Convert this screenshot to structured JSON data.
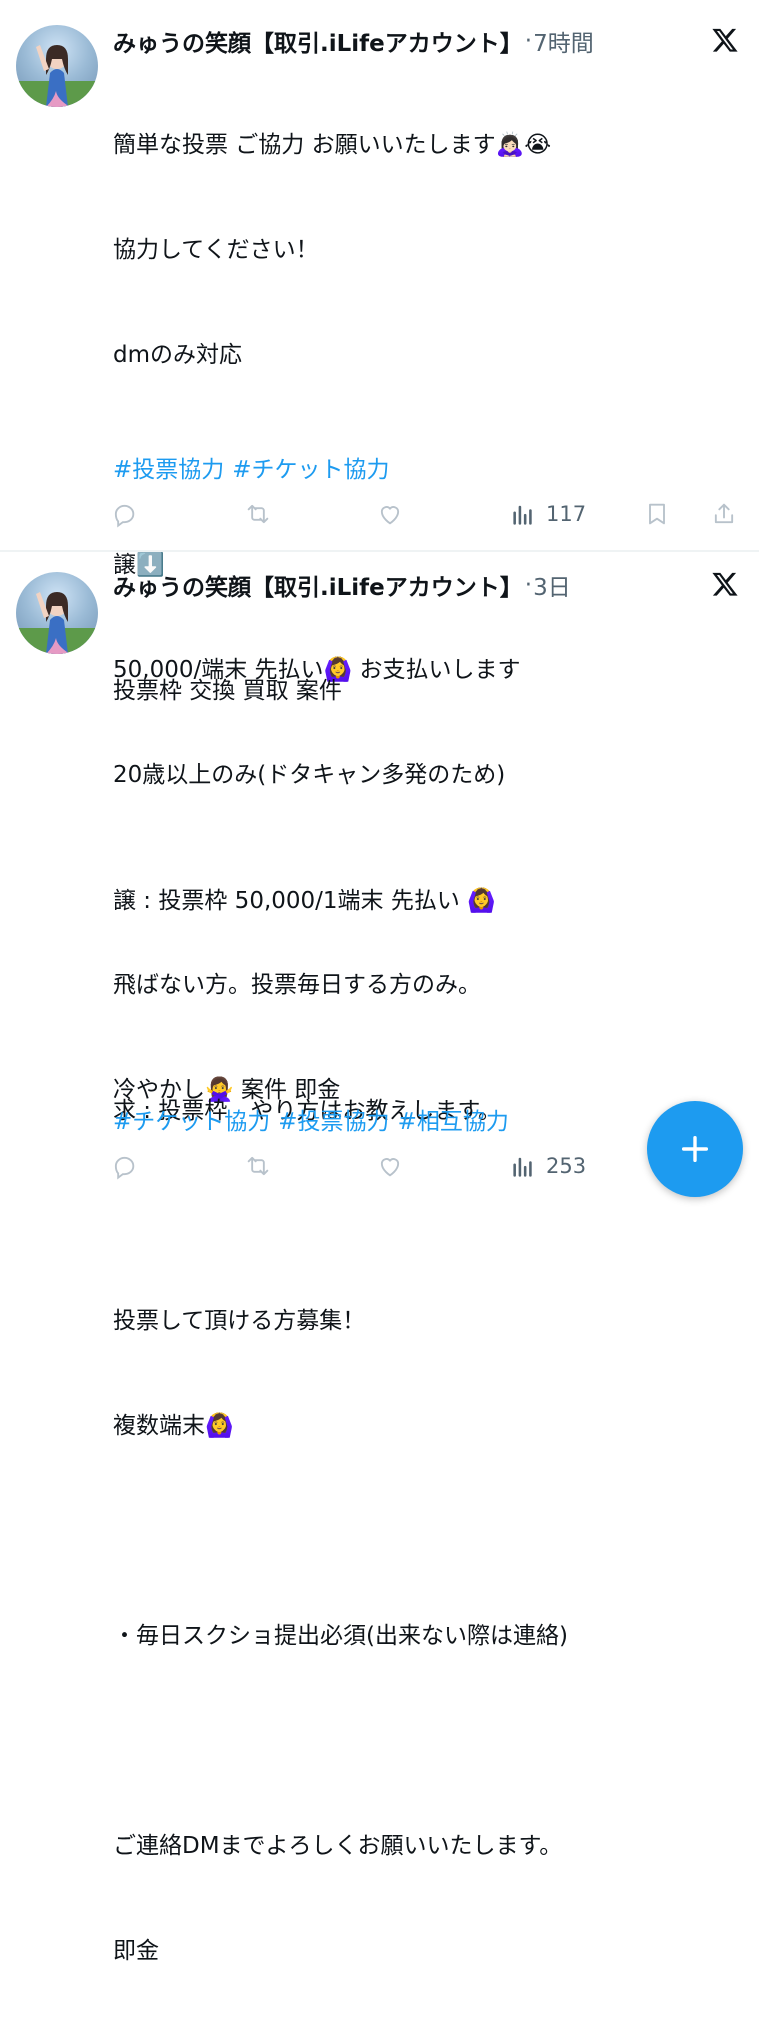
{
  "tweets": [
    {
      "author": "みゅうの笑顔【取引.iLifeアカウント】",
      "separator": "·",
      "time": "7時間",
      "lines": [
        "簡単な投票 ご協力 お願いいたします🙇🏻‍♀️😭",
        "協力してください！",
        "dmのみ対応",
        "",
        "譲⬇️",
        "50,000/端末 先払い🙆‍♀️ お支払いします",
        "20歳以上のみ(ドタキャン多発のため)",
        "",
        "飛ばない方。投票毎日する方のみ。",
        "冷やかし🙅‍♀️ 案件 即金"
      ],
      "hashtags": [
        "#投票協力",
        "#チケット協力"
      ],
      "views": "117"
    },
    {
      "author": "みゅうの笑顔【取引.iLifeアカウント】",
      "separator": "·",
      "time": "3日",
      "lines": [
        "投票枠 交換 買取 案件",
        "",
        "譲 : 投票枠 50,000/1端末 先払い 🙆‍♀️",
        "",
        "求 : 投票枠　やり方はお教えします。",
        "",
        "投票して頂ける方募集！",
        "複数端末🙆‍♀️",
        "",
        "・毎日スクショ提出必須(出来ない際は連絡)",
        "",
        "ご連絡DMまでよろしくお願いいたします。",
        "即金"
      ],
      "hashtags": [
        "#チケット協力",
        "#投票協力",
        "#相互協力"
      ],
      "views": "253"
    }
  ],
  "icons": {
    "reply": "reply-icon",
    "retweet": "retweet-icon",
    "like": "like-icon",
    "views": "views-icon",
    "bookmark": "bookmark-icon",
    "share": "share-icon",
    "brand": "x-logo-icon",
    "compose": "plus-icon"
  },
  "colors": {
    "accent": "#1d9bf0",
    "muted": "#536471",
    "text": "#0f1419"
  }
}
